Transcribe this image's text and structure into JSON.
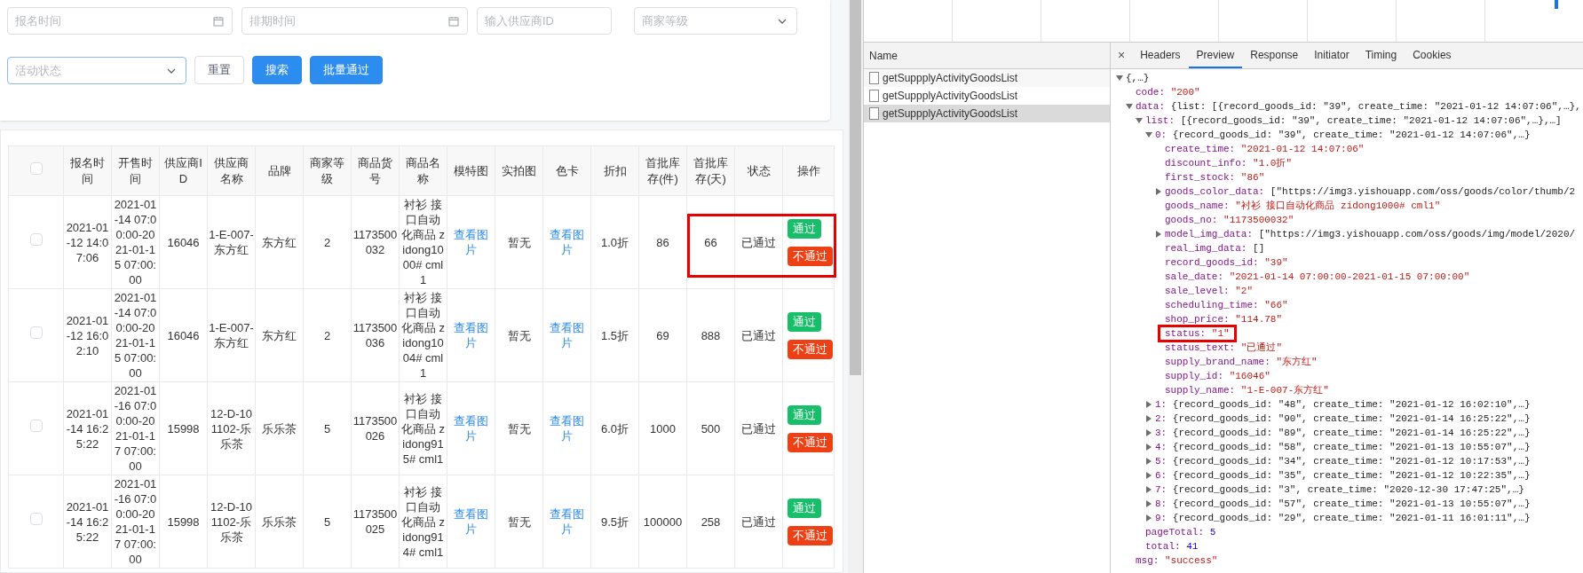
{
  "filters": [
    {
      "kind": "date",
      "placeholder": "报名时间",
      "focused": false
    },
    {
      "kind": "date",
      "placeholder": "排期时间",
      "focused": false
    },
    {
      "kind": "input",
      "placeholder": "输入供应商ID",
      "focused": false
    },
    {
      "kind": "select",
      "placeholder": "商家等级",
      "focused": false
    },
    {
      "kind": "select",
      "placeholder": "活动状态",
      "focused": true
    }
  ],
  "buttons": [
    {
      "label": "重置",
      "kind": "default"
    },
    {
      "label": "搜索",
      "kind": "primary"
    },
    {
      "label": "批量通过",
      "kind": "primary"
    }
  ],
  "table": {
    "select_all_checked": false,
    "columns": [
      "报名时间",
      "开售时间",
      "供应商ID",
      "供应商名称",
      "品牌",
      "商家等级",
      "商品货号",
      "商品名称",
      "模特图",
      "实拍图",
      "色卡",
      "折扣",
      "首批库存(件)",
      "首批库存(天)",
      "状态",
      "操作"
    ],
    "rows": [
      {
        "checked": false,
        "highlighted": true,
        "signup_time": "2021-01-12 14:07:06",
        "sale_time": "2021-01-14 07:00:00-2021-01-15 07:00:00",
        "supplier_id": "16046",
        "supplier_name": "1-E-007-东方红",
        "brand": "东方红",
        "level": "2",
        "goods_no": "1173500032",
        "goods_name": "衬衫 接口自动化商品 zidong1000# cml1",
        "model_image": "查看图片",
        "real_image": "暂无",
        "color_card": "查看图片",
        "discount": "1.0折",
        "stock_pieces": "86",
        "stock_days": "66",
        "status": "已通过",
        "actions": [
          "通过",
          "不通过"
        ]
      },
      {
        "checked": false,
        "highlighted": false,
        "signup_time": "2021-01-12 16:02:10",
        "sale_time": "2021-01-14 07:00:00-2021-01-15 07:00:00",
        "supplier_id": "16046",
        "supplier_name": "1-E-007-东方红",
        "brand": "东方红",
        "level": "2",
        "goods_no": "1173500036",
        "goods_name": "衬衫 接口自动化商品 zidong1004# cml1",
        "model_image": "查看图片",
        "real_image": "暂无",
        "color_card": "查看图片",
        "discount": "1.5折",
        "stock_pieces": "69",
        "stock_days": "888",
        "status": "已通过",
        "actions": [
          "通过",
          "不通过"
        ]
      },
      {
        "checked": false,
        "highlighted": false,
        "signup_time": "2021-01-14 16:25:22",
        "sale_time": "2021-01-16 07:00:00-2021-01-17 07:00:00",
        "supplier_id": "15998",
        "supplier_name": "12-D-101102-乐乐茶",
        "brand": "乐乐茶",
        "level": "5",
        "goods_no": "1173500026",
        "goods_name": "衬衫 接口自动化商品 zidong915# cml1",
        "model_image": "查看图片",
        "real_image": "暂无",
        "color_card": "查看图片",
        "discount": "6.0折",
        "stock_pieces": "1000",
        "stock_days": "500",
        "status": "已通过",
        "actions": [
          "通过",
          "不通过"
        ]
      },
      {
        "checked": false,
        "highlighted": false,
        "signup_time": "2021-01-14 16:25:22",
        "sale_time": "2021-01-16 07:00:00-2021-01-17 07:00:00",
        "supplier_id": "15998",
        "supplier_name": "12-D-101102-乐乐茶",
        "brand": "乐乐茶",
        "level": "5",
        "goods_no": "1173500025",
        "goods_name": "衬衫 接口自动化商品 zidong914# cml1",
        "model_image": "查看图片",
        "real_image": "暂无",
        "color_card": "查看图片",
        "discount": "9.5折",
        "stock_pieces": "100000",
        "stock_days": "258",
        "status": "已通过",
        "actions": [
          "通过",
          "不通过"
        ]
      }
    ]
  },
  "devtools": {
    "name_header": "Name",
    "requests": [
      {
        "name": "getSuppplyActivityGoodsList",
        "selected": false
      },
      {
        "name": "getSuppplyActivityGoodsList",
        "selected": false
      },
      {
        "name": "getSuppplyActivityGoodsList",
        "selected": true
      }
    ],
    "close": "×",
    "tabs": [
      {
        "label": "Headers",
        "selected": false
      },
      {
        "label": "Preview",
        "selected": true
      },
      {
        "label": "Response",
        "selected": false
      },
      {
        "label": "Initiator",
        "selected": false
      },
      {
        "label": "Timing",
        "selected": false
      },
      {
        "label": "Cookies",
        "selected": false
      }
    ],
    "tree": [
      {
        "summary": "{,…}",
        "expanded": true,
        "children": [
          {
            "key": "code:",
            "value": "\"200\"",
            "kind": "string"
          },
          {
            "key": "data:",
            "summary": "{list: [{record_goods_id: \"39\", create_time: \"2021-01-12 14:07:06\",…},",
            "expanded": true,
            "children": [
              {
                "key": "list:",
                "summary": "[{record_goods_id: \"39\", create_time: \"2021-01-12 14:07:06\",…},…]",
                "expanded": true,
                "children": [
                  {
                    "key": "0:",
                    "summary": "{record_goods_id: \"39\", create_time: \"2021-01-12 14:07:06\",…}",
                    "expanded": true,
                    "children": [
                      {
                        "key": "create_time:",
                        "value": "\"2021-01-12 14:07:06\"",
                        "kind": "string"
                      },
                      {
                        "key": "discount_info:",
                        "value": "\"1.0折\"",
                        "kind": "string"
                      },
                      {
                        "key": "first_stock:",
                        "value": "\"86\"",
                        "kind": "string"
                      },
                      {
                        "key": "goods_color_data:",
                        "summary": "[\"https://img3.yishouapp.com/oss/goods/color/thumb/2",
                        "expanded": false
                      },
                      {
                        "key": "goods_name:",
                        "value": "\"衬衫  接口自动化商品  zidong1000#  cml1\"",
                        "kind": "string"
                      },
                      {
                        "key": "goods_no:",
                        "value": "\"1173500032\"",
                        "kind": "string"
                      },
                      {
                        "key": "model_img_data:",
                        "summary": "[\"https://img3.yishouapp.com/oss/goods/img/model/2020/",
                        "expanded": false
                      },
                      {
                        "key": "real_img_data:",
                        "value": "[]",
                        "kind": "plain"
                      },
                      {
                        "key": "record_goods_id:",
                        "value": "\"39\"",
                        "kind": "string"
                      },
                      {
                        "key": "sale_date:",
                        "value": "\"2021-01-14 07:00:00-2021-01-15 07:00:00\"",
                        "kind": "string"
                      },
                      {
                        "key": "sale_level:",
                        "value": "\"2\"",
                        "kind": "string"
                      },
                      {
                        "key": "scheduling_time:",
                        "value": "\"66\"",
                        "kind": "string"
                      },
                      {
                        "key": "shop_price:",
                        "value": "\"114.78\"",
                        "kind": "string"
                      },
                      {
                        "key": "status:",
                        "value": "\"1\"",
                        "kind": "string",
                        "highlighted": true
                      },
                      {
                        "key": "status_text:",
                        "value": "\"已通过\"",
                        "kind": "string"
                      },
                      {
                        "key": "supply_brand_name:",
                        "value": "\"东方红\"",
                        "kind": "string"
                      },
                      {
                        "key": "supply_id:",
                        "value": "\"16046\"",
                        "kind": "string"
                      },
                      {
                        "key": "supply_name:",
                        "value": "\"1-E-007-东方红\"",
                        "kind": "string"
                      }
                    ]
                  },
                  {
                    "key": "1:",
                    "summary": "{record_goods_id: \"48\", create_time: \"2021-01-12 16:02:10\",…}",
                    "expanded": false
                  },
                  {
                    "key": "2:",
                    "summary": "{record_goods_id: \"90\", create_time: \"2021-01-14 16:25:22\",…}",
                    "expanded": false
                  },
                  {
                    "key": "3:",
                    "summary": "{record_goods_id: \"89\", create_time: \"2021-01-14 16:25:22\",…}",
                    "expanded": false
                  },
                  {
                    "key": "4:",
                    "summary": "{record_goods_id: \"58\", create_time: \"2021-01-13 10:55:07\",…}",
                    "expanded": false
                  },
                  {
                    "key": "5:",
                    "summary": "{record_goods_id: \"34\", create_time: \"2021-01-12 10:17:53\",…}",
                    "expanded": false
                  },
                  {
                    "key": "6:",
                    "summary": "{record_goods_id: \"35\", create_time: \"2021-01-12 10:22:35\",…}",
                    "expanded": false
                  },
                  {
                    "key": "7:",
                    "summary": "{record_goods_id: \"3\", create_time: \"2020-12-30 17:47:25\",…}",
                    "expanded": false
                  },
                  {
                    "key": "8:",
                    "summary": "{record_goods_id: \"57\", create_time: \"2021-01-13 10:55:07\",…}",
                    "expanded": false
                  },
                  {
                    "key": "9:",
                    "summary": "{record_goods_id: \"29\", create_time: \"2021-01-11 16:01:11\",…}",
                    "expanded": false
                  }
                ]
              },
              {
                "key": "pageTotal:",
                "value": "5",
                "kind": "number"
              },
              {
                "key": "total:",
                "value": "41",
                "kind": "number"
              }
            ]
          },
          {
            "key": "msg:",
            "value": "\"success\"",
            "kind": "string"
          }
        ]
      }
    ]
  }
}
